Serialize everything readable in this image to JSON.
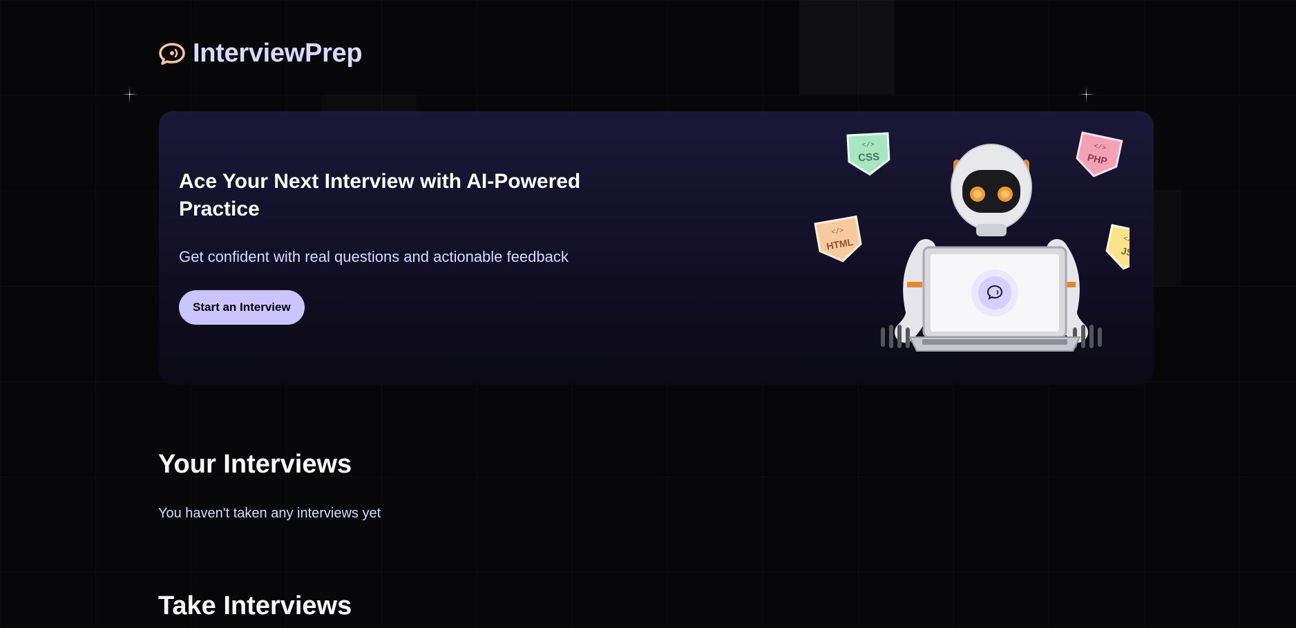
{
  "brand": {
    "name": "InterviewPrep",
    "icon": "chat-bubble-icon",
    "accent_color": "#dcd8ff",
    "icon_color": "#f7c6a3"
  },
  "hero": {
    "title": "Ace Your Next Interview with AI-Powered Practice",
    "subtitle": "Get confident with real questions and actionable feedback",
    "cta_label": "Start an Interview",
    "cta_color": "#cac5fe",
    "illustration": "robot-with-laptop-illustration",
    "badges": [
      {
        "label": "CSS",
        "color": "#a8e6c2"
      },
      {
        "label": "PHP",
        "color": "#f4a0b5"
      },
      {
        "label": "HTML",
        "color": "#f9c9a0"
      },
      {
        "label": "JS",
        "color": "#fbe38c"
      }
    ]
  },
  "your_interviews": {
    "title": "Your Interviews",
    "empty_message": "You haven't taken any interviews yet"
  },
  "take_interviews": {
    "title": "Take Interviews"
  },
  "colors": {
    "background": "#08080a",
    "hero_background": "#1b1838",
    "text_muted": "#d6dcff"
  }
}
